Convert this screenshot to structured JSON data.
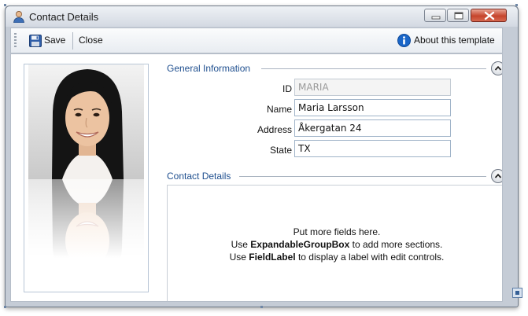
{
  "window": {
    "title": "Contact Details"
  },
  "toolbar": {
    "save_label": "Save",
    "close_label": "Close",
    "about_label": "About this template"
  },
  "general": {
    "title": "General Information",
    "fields": [
      {
        "label": "ID",
        "value": "MARIA"
      },
      {
        "label": "Name",
        "value": "Maria Larsson"
      },
      {
        "label": "Address",
        "value": "Åkergatan 24"
      },
      {
        "label": "State",
        "value": "TX"
      }
    ]
  },
  "contact": {
    "title": "Contact Details",
    "hint": {
      "line1": "Put more fields here.",
      "line2_prefix": "Use ",
      "line2_bold": "ExpandableGroupBox",
      "line2_suffix": " to add more sections.",
      "line3_prefix": "Use ",
      "line3_bold": "FieldLabel",
      "line3_suffix": " to display a label with edit controls."
    }
  },
  "icons": {
    "title": "user-icon",
    "save": "floppy-disk-icon",
    "about": "info-icon",
    "expander": "chevron-up-icon"
  },
  "colors": {
    "group_title": "#1f4f8f",
    "close_button": "#c6452d",
    "input_border": "#9fb3c8",
    "info_blue": "#1a66c8"
  }
}
